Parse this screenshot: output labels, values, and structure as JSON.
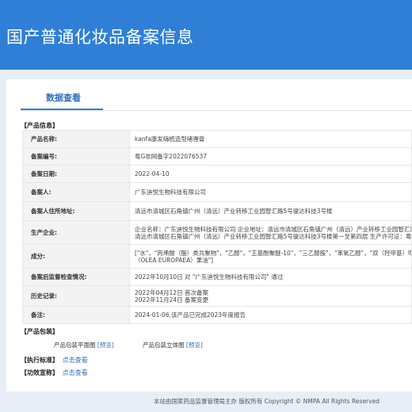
{
  "header": {
    "title": "国产普通化妆品备案信息"
  },
  "tabs": [
    {
      "label": "数据查看"
    }
  ],
  "product_info": {
    "section_title": "【产品信息】",
    "rows": [
      {
        "label": "产品名称:",
        "value": "kanfa康发嗨梳造型啫喱膏"
      },
      {
        "label": "备案编号:",
        "value": "粤G妆网备字2022076537"
      },
      {
        "label": "备案日期:",
        "value": "2022-04-10"
      },
      {
        "label": "备案人:",
        "value": "广东迪悦生物科技有限公司"
      },
      {
        "label": "备案人住所地址:",
        "value": "清远市清城区石角镇广州（清远）产业转移工业园智汇路5号骏达科技3号楼"
      },
      {
        "label": "生产企业:",
        "line1": "企业名称：广东迪悦生物科技有限公司 企业地址：清远市清城区石角镇广州（清远）产业转移工业园智汇路",
        "line2": "清远市清城区石角镇广州（清远）产业转移工业园智汇路5号骏达科技3号楼第一至第四层 生产许可证：粤妆"
      },
      {
        "label": "成分:",
        "line1": "[\"水\"，\"丙烯酸（酯）类共聚物\"，\"乙醇\"，\"王基酚聚醚-10\"，\"三乙醇胺\"，\"苯氧乙醇\"，\"双（羟甲基）咪唑",
        "line2": "（OLEA EUROPAEA）果油\"]"
      },
      {
        "label": "备案后监督检查情况:",
        "value": "2022年10月10日 对 \"广东迪悦生物科技有限公司\" 通过"
      },
      {
        "label": "历史记录:",
        "line1": "2022年04月12日 首次备案",
        "line2": "2022年11月24日 备案变更"
      },
      {
        "label": "备注:",
        "value": "2024-01-06,该产品已完成2023年度报告"
      }
    ]
  },
  "packaging": {
    "section_title": "【产品包装】",
    "flat_label": "产品包装平面图",
    "flat_link": "[预览]",
    "3d_label": "产品包装立体图",
    "3d_link": "[预览]"
  },
  "standard": {
    "section_title": "【执行标准】",
    "link": "点击查看"
  },
  "efficacy": {
    "section_title": "【功效宣称】",
    "link": "点击查看"
  },
  "footer": {
    "text": "本站由国家药品监督管理局主办 版权所有 Copyright © NMPA All Rights Reserved"
  },
  "colors": {
    "header_bg": "#2f7fd6",
    "link": "#2f6fbf",
    "page_bg": "#e7eef7"
  }
}
